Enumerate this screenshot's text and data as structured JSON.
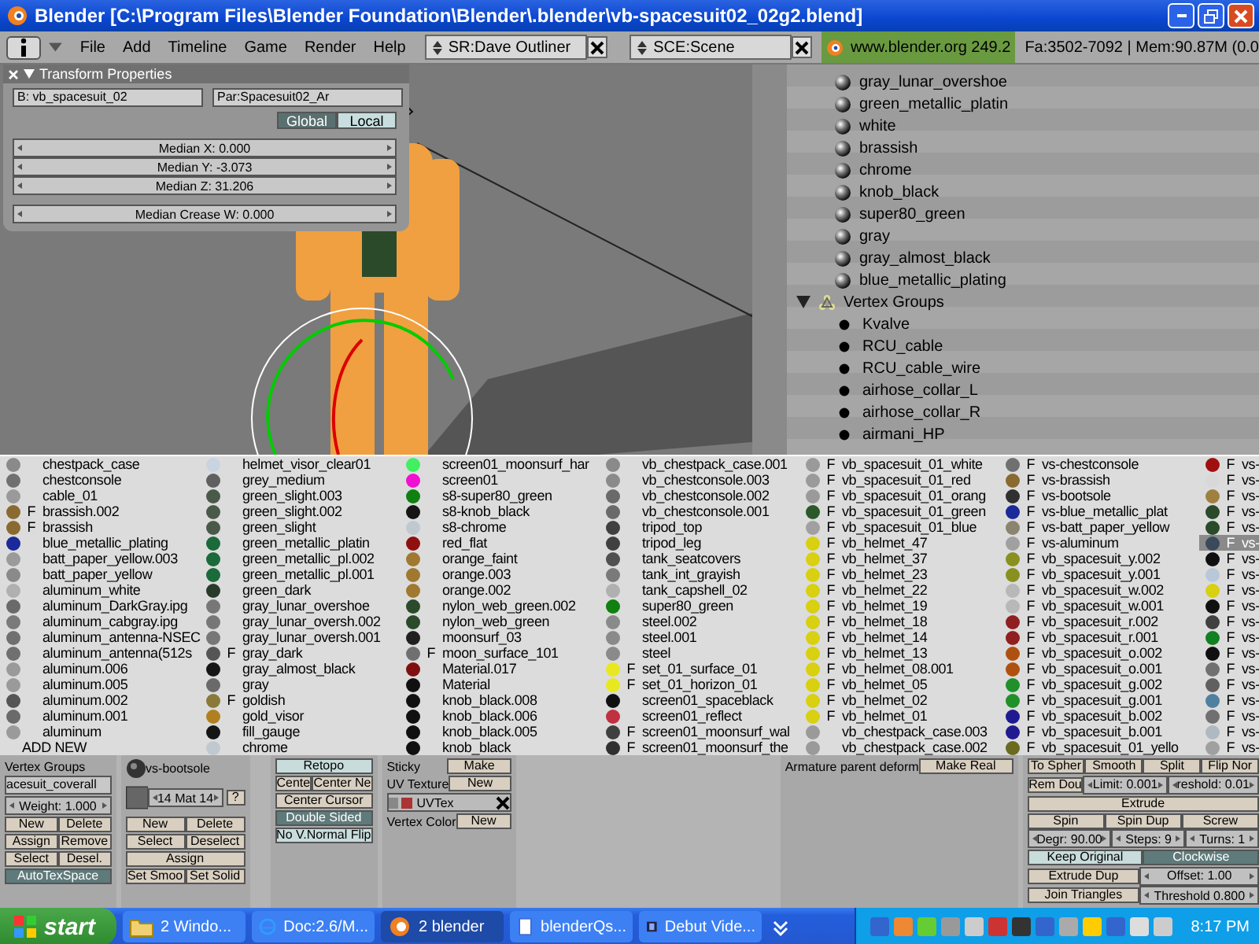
{
  "window": {
    "title": "Blender [C:\\Program Files\\Blender Foundation\\Blender\\.blender\\vb-spacesuit02_02g2.blend]"
  },
  "header": {
    "menus": [
      "File",
      "Add",
      "Timeline",
      "Game",
      "Render",
      "Help"
    ],
    "screen_field": {
      "value": "SR:Dave Outliner"
    },
    "scene_field": {
      "value": "SCE:Scene"
    },
    "version": "www.blender.org 249.2",
    "stats": "Fa:3502-7092 | Mem:90.87M (0.0"
  },
  "transform_panel": {
    "title": "Transform Properties",
    "bone_field": "B: vb_spacesuit_02",
    "parent_field": "Par:Spacesuit02_Ar",
    "toggles": [
      {
        "label": "Global",
        "selected": true
      },
      {
        "label": "Local",
        "selected": false
      }
    ],
    "fields": [
      "Median X: 0.000",
      "Median Y: -3.073",
      "Median Z: 31.206"
    ],
    "crease_field": "Median Crease W: 0.000"
  },
  "outliner": {
    "rows": [
      {
        "kind": "material",
        "label": "gray_lunar_overshoe"
      },
      {
        "kind": "material",
        "label": "green_metallic_platin"
      },
      {
        "kind": "material",
        "label": "white"
      },
      {
        "kind": "material",
        "label": "brassish"
      },
      {
        "kind": "material",
        "label": "chrome"
      },
      {
        "kind": "material",
        "label": "knob_black"
      },
      {
        "kind": "material",
        "label": "super80_green"
      },
      {
        "kind": "material",
        "label": "gray"
      },
      {
        "kind": "material",
        "label": "gray_almost_black"
      },
      {
        "kind": "material",
        "label": "blue_metallic_plating"
      },
      {
        "kind": "group",
        "label": "Vertex Groups",
        "expanded": true,
        "children": [
          {
            "label": "Kvalve"
          },
          {
            "label": "RCU_cable"
          },
          {
            "label": "RCU_cable_wire"
          },
          {
            "label": "airhose_collar_L"
          },
          {
            "label": "airhose_collar_R"
          },
          {
            "label": "airmani_HP"
          }
        ]
      }
    ]
  },
  "material_menu": {
    "columns": [
      {
        "items": [
          {
            "kind": "material",
            "name": "chestpack_case",
            "color": "#8a8a8a",
            "selected": false
          },
          {
            "kind": "material",
            "name": "chestconsole",
            "color": "#707070",
            "selected": false
          },
          {
            "kind": "material",
            "name": "cable_01",
            "color": "#9a9a9a",
            "selected": false
          },
          {
            "kind": "material",
            "flag": "F",
            "name": "brassish.002",
            "color": "#8a6a30",
            "selected": false
          },
          {
            "kind": "material",
            "flag": "F",
            "name": "brassish",
            "color": "#8a6a30",
            "selected": false
          },
          {
            "kind": "material",
            "name": "blue_metallic_plating",
            "color": "#1a2a9a",
            "selected": false
          },
          {
            "kind": "material",
            "name": "batt_paper_yellow.003",
            "color": "#9a9a9a",
            "selected": false
          },
          {
            "kind": "material",
            "name": "batt_paper_yellow",
            "color": "#8a8a8a",
            "selected": false
          },
          {
            "kind": "material",
            "name": "aluminum_white",
            "color": "#b0b0b0",
            "selected": false
          },
          {
            "kind": "material",
            "name": "aluminum_DarkGray.ipg",
            "color": "#6a6a6a",
            "selected": false
          },
          {
            "kind": "material",
            "name": "aluminum_cabgray.ipg",
            "color": "#7a7a7a",
            "selected": false
          },
          {
            "kind": "material",
            "name": "aluminum_antenna-NSEC",
            "color": "#707070",
            "selected": false
          },
          {
            "kind": "material",
            "name": "aluminum_antenna(512s",
            "color": "#707070",
            "selected": false
          },
          {
            "kind": "material",
            "name": "aluminum.006",
            "color": "#9a9a9a",
            "selected": false
          },
          {
            "kind": "material",
            "name": "aluminum.005",
            "color": "#9a9a9a",
            "selected": false
          },
          {
            "kind": "material",
            "name": "aluminum.002",
            "color": "#555555",
            "selected": false
          },
          {
            "kind": "material",
            "name": "aluminum.001",
            "color": "#6a6a6a",
            "selected": false
          },
          {
            "kind": "material",
            "name": "aluminum",
            "color": "#9a9a9a",
            "selected": false
          },
          {
            "kind": "add",
            "name": "ADD NEW",
            "selected": false
          }
        ]
      },
      {
        "items": [
          {
            "kind": "material",
            "name": "helmet_visor_clear01",
            "color": "#c8d4e0",
            "selected": false
          },
          {
            "kind": "material",
            "name": "grey_medium",
            "color": "#606060",
            "selected": false
          },
          {
            "kind": "material",
            "name": "green_slight.003",
            "color": "#4a5a4a",
            "selected": false
          },
          {
            "kind": "material",
            "name": "green_slight.002",
            "color": "#4a5a4a",
            "selected": false
          },
          {
            "kind": "material",
            "name": "green_slight",
            "color": "#4a5a4a",
            "selected": false
          },
          {
            "kind": "material",
            "name": "green_metallic_platin",
            "color": "#1a6a3a",
            "selected": false
          },
          {
            "kind": "material",
            "name": "green_metallic_pl.002",
            "color": "#1a6a3a",
            "selected": false
          },
          {
            "kind": "material",
            "name": "green_metallic_pl.001",
            "color": "#1a6a3a",
            "selected": false
          },
          {
            "kind": "material",
            "name": "green_dark",
            "color": "#2a3a2a",
            "selected": false
          },
          {
            "kind": "material",
            "name": "gray_lunar_overshoe",
            "color": "#777777",
            "selected": false
          },
          {
            "kind": "material",
            "name": "gray_lunar_oversh.002",
            "color": "#777777",
            "selected": false
          },
          {
            "kind": "material",
            "name": "gray_lunar_oversh.001",
            "color": "#777777",
            "selected": false
          },
          {
            "kind": "material",
            "flag": "F",
            "name": "gray_dark",
            "color": "#555555",
            "selected": false
          },
          {
            "kind": "material",
            "name": "gray_almost_black",
            "color": "#151515",
            "selected": false
          },
          {
            "kind": "material",
            "name": "gray",
            "color": "#6a6a6a",
            "selected": false
          },
          {
            "kind": "material",
            "flag": "F",
            "name": "goldish",
            "color": "#8a7a3a",
            "selected": false
          },
          {
            "kind": "material",
            "name": "gold_visor",
            "color": "#b08020",
            "selected": false
          },
          {
            "kind": "material",
            "name": "fill_gauge",
            "color": "#151515",
            "selected": false
          },
          {
            "kind": "material",
            "name": "chrome",
            "color": "#c0c8d0",
            "selected": false
          }
        ]
      },
      {
        "items": [
          {
            "kind": "material",
            "name": "screen01_moonsurf_har",
            "color": "#40f060",
            "selected": false
          },
          {
            "kind": "material",
            "name": "screen01",
            "color": "#f010d0",
            "selected": false
          },
          {
            "kind": "material",
            "name": "s8-super80_green",
            "color": "#108010",
            "selected": false
          },
          {
            "kind": "material",
            "name": "s8-knob_black",
            "color": "#151515",
            "selected": false
          },
          {
            "kind": "material",
            "name": "s8-chrome",
            "color": "#c0c8d0",
            "selected": false
          },
          {
            "kind": "material",
            "name": "red_flat",
            "color": "#901010",
            "selected": false
          },
          {
            "kind": "material",
            "name": "orange_faint",
            "color": "#a07830",
            "selected": false
          },
          {
            "kind": "material",
            "name": "orange.003",
            "color": "#a07830",
            "selected": false
          },
          {
            "kind": "material",
            "name": "orange.002",
            "color": "#a07830",
            "selected": false
          },
          {
            "kind": "material",
            "name": "nylon_web_green.002",
            "color": "#2a4a2a",
            "selected": false
          },
          {
            "kind": "material",
            "name": "nylon_web_green",
            "color": "#2a4a2a",
            "selected": false
          },
          {
            "kind": "material",
            "name": "moonsurf_03",
            "color": "#202020",
            "selected": false
          },
          {
            "kind": "material",
            "flag": "F",
            "name": "moon_surface_101",
            "color": "#707070",
            "selected": false
          },
          {
            "kind": "material",
            "name": "Material.017",
            "color": "#801010",
            "selected": false
          },
          {
            "kind": "material",
            "name": "Material",
            "color": "#101010",
            "selected": false
          },
          {
            "kind": "material",
            "name": "knob_black.008",
            "color": "#101010",
            "selected": false
          },
          {
            "kind": "material",
            "name": "knob_black.006",
            "color": "#101010",
            "selected": false
          },
          {
            "kind": "material",
            "name": "knob_black.005",
            "color": "#101010",
            "selected": false
          },
          {
            "kind": "material",
            "name": "knob_black",
            "color": "#101010",
            "selected": false
          }
        ]
      },
      {
        "items": [
          {
            "kind": "material",
            "name": "vb_chestpack_case.001",
            "color": "#8a8a8a",
            "selected": false
          },
          {
            "kind": "material",
            "name": "vb_chestconsole.003",
            "color": "#8a8a8a",
            "selected": false
          },
          {
            "kind": "material",
            "name": "vb_chestconsole.002",
            "color": "#6a6a6a",
            "selected": false
          },
          {
            "kind": "material",
            "name": "vb_chestconsole.001",
            "color": "#6a6a6a",
            "selected": false
          },
          {
            "kind": "material",
            "name": "tripod_top",
            "color": "#404040",
            "selected": false
          },
          {
            "kind": "material",
            "name": "tripod_leg",
            "color": "#404040",
            "selected": false
          },
          {
            "kind": "material",
            "name": "tank_seatcovers",
            "color": "#505050",
            "selected": false
          },
          {
            "kind": "material",
            "name": "tank_int_grayish",
            "color": "#7a7a7a",
            "selected": false
          },
          {
            "kind": "material",
            "name": "tank_capshell_02",
            "color": "#b0b0b0",
            "selected": false
          },
          {
            "kind": "material",
            "name": "super80_green",
            "color": "#108010",
            "selected": false
          },
          {
            "kind": "material",
            "name": "steel.002",
            "color": "#8a8a8a",
            "selected": false
          },
          {
            "kind": "material",
            "name": "steel.001",
            "color": "#8a8a8a",
            "selected": false
          },
          {
            "kind": "material",
            "name": "steel",
            "color": "#8a8a8a",
            "selected": false
          },
          {
            "kind": "material",
            "flag": "F",
            "name": "set_01_surface_01",
            "color": "#e8e820",
            "selected": false
          },
          {
            "kind": "material",
            "flag": "F",
            "name": "set_01_horizon_01",
            "color": "#e8e820",
            "selected": false
          },
          {
            "kind": "material",
            "name": "screen01_spaceblack",
            "color": "#101010",
            "selected": false
          },
          {
            "kind": "material",
            "name": "screen01_reflect",
            "color": "#c03040",
            "selected": false
          },
          {
            "kind": "material",
            "flag": "F",
            "name": "screen01_moonsurf_wal",
            "color": "#404040",
            "selected": false
          },
          {
            "kind": "material",
            "flag": "F",
            "name": "screen01_moonsurf_the",
            "color": "#303030",
            "selected": false
          }
        ]
      },
      {
        "items": [
          {
            "kind": "material",
            "flag": "F",
            "name": "vb_spacesuit_01_white",
            "color": "#9a9a9a",
            "selected": false
          },
          {
            "kind": "material",
            "flag": "F",
            "name": "vb_spacesuit_01_red",
            "color": "#9a9a9a",
            "selected": false
          },
          {
            "kind": "material",
            "flag": "F",
            "name": "vb_spacesuit_01_orang",
            "color": "#9a9a9a",
            "selected": false
          },
          {
            "kind": "material",
            "flag": "F",
            "name": "vb_spacesuit_01_green",
            "color": "#2a5a2a",
            "selected": false
          },
          {
            "kind": "material",
            "flag": "F",
            "name": "vb_spacesuit_01_blue",
            "color": "#a0a0a0",
            "selected": false
          },
          {
            "kind": "material",
            "flag": "F",
            "name": "vb_helmet_47",
            "color": "#d8d010",
            "selected": false
          },
          {
            "kind": "material",
            "flag": "F",
            "name": "vb_helmet_37",
            "color": "#d8d010",
            "selected": false
          },
          {
            "kind": "material",
            "flag": "F",
            "name": "vb_helmet_23",
            "color": "#d8d010",
            "selected": false
          },
          {
            "kind": "material",
            "flag": "F",
            "name": "vb_helmet_22",
            "color": "#d8d010",
            "selected": false
          },
          {
            "kind": "material",
            "flag": "F",
            "name": "vb_helmet_19",
            "color": "#d8d010",
            "selected": false
          },
          {
            "kind": "material",
            "flag": "F",
            "name": "vb_helmet_18",
            "color": "#d8d010",
            "selected": false
          },
          {
            "kind": "material",
            "flag": "F",
            "name": "vb_helmet_14",
            "color": "#d8d010",
            "selected": false
          },
          {
            "kind": "material",
            "flag": "F",
            "name": "vb_helmet_13",
            "color": "#d8d010",
            "selected": false
          },
          {
            "kind": "material",
            "flag": "F",
            "name": "vb_helmet_08.001",
            "color": "#d8d010",
            "selected": false
          },
          {
            "kind": "material",
            "flag": "F",
            "name": "vb_helmet_05",
            "color": "#d8d010",
            "selected": false
          },
          {
            "kind": "material",
            "flag": "F",
            "name": "vb_helmet_02",
            "color": "#d8d010",
            "selected": false
          },
          {
            "kind": "material",
            "flag": "F",
            "name": "vb_helmet_01",
            "color": "#d8d010",
            "selected": false
          },
          {
            "kind": "material",
            "name": "vb_chestpack_case.003",
            "color": "#9a9a9a",
            "selected": false
          },
          {
            "kind": "material",
            "name": "vb_chestpack_case.002",
            "color": "#9a9a9a",
            "selected": false
          }
        ]
      },
      {
        "items": [
          {
            "kind": "material",
            "flag": "F",
            "name": "vs-chestconsole",
            "color": "#707070",
            "selected": false
          },
          {
            "kind": "material",
            "flag": "F",
            "name": "vs-brassish",
            "color": "#8a6a30",
            "selected": false
          },
          {
            "kind": "material",
            "flag": "F",
            "name": "vs-bootsole",
            "color": "#303030",
            "selected": false
          },
          {
            "kind": "material",
            "flag": "F",
            "name": "vs-blue_metallic_plat",
            "color": "#1a2a9a",
            "selected": false
          },
          {
            "kind": "material",
            "flag": "F",
            "name": "vs-batt_paper_yellow",
            "color": "#8a8470",
            "selected": false
          },
          {
            "kind": "material",
            "flag": "F",
            "name": "vs-aluminum",
            "color": "#a0a0a0",
            "selected": false
          },
          {
            "kind": "material",
            "flag": "F",
            "name": "vb_spacesuit_y.002",
            "color": "#8a9020",
            "selected": false
          },
          {
            "kind": "material",
            "flag": "F",
            "name": "vb_spacesuit_y.001",
            "color": "#8a9020",
            "selected": false
          },
          {
            "kind": "material",
            "flag": "F",
            "name": "vb_spacesuit_w.002",
            "color": "#b8b8b8",
            "selected": false
          },
          {
            "kind": "material",
            "flag": "F",
            "name": "vb_spacesuit_w.001",
            "color": "#b8b8b8",
            "selected": false
          },
          {
            "kind": "material",
            "flag": "F",
            "name": "vb_spacesuit_r.002",
            "color": "#902020",
            "selected": false
          },
          {
            "kind": "material",
            "flag": "F",
            "name": "vb_spacesuit_r.001",
            "color": "#902020",
            "selected": false
          },
          {
            "kind": "material",
            "flag": "F",
            "name": "vb_spacesuit_o.002",
            "color": "#b05010",
            "selected": false
          },
          {
            "kind": "material",
            "flag": "F",
            "name": "vb_spacesuit_o.001",
            "color": "#b05010",
            "selected": false
          },
          {
            "kind": "material",
            "flag": "F",
            "name": "vb_spacesuit_g.002",
            "color": "#20902a",
            "selected": false
          },
          {
            "kind": "material",
            "flag": "F",
            "name": "vb_spacesuit_g.001",
            "color": "#20902a",
            "selected": false
          },
          {
            "kind": "material",
            "flag": "F",
            "name": "vb_spacesuit_b.002",
            "color": "#201a90",
            "selected": false
          },
          {
            "kind": "material",
            "flag": "F",
            "name": "vb_spacesuit_b.001",
            "color": "#201a90",
            "selected": false
          },
          {
            "kind": "material",
            "flag": "F",
            "name": "vb_spacesuit_01_yello",
            "color": "#6a6a20",
            "selected": false
          }
        ]
      },
      {
        "items": [
          {
            "kind": "material",
            "flag": "F",
            "name": "vs-",
            "color": "#a01010",
            "selected": false
          },
          {
            "kind": "material",
            "flag": "F",
            "name": "vs-",
            "color": "#d8d8d8",
            "selected": false
          },
          {
            "kind": "material",
            "flag": "F",
            "name": "vs-",
            "color": "#a08040",
            "selected": false
          },
          {
            "kind": "material",
            "flag": "F",
            "name": "vs-",
            "color": "#2a4a2a",
            "selected": false
          },
          {
            "kind": "material",
            "flag": "F",
            "name": "vs-",
            "color": "#2a4a2a",
            "selected": false
          },
          {
            "kind": "material",
            "flag": "F",
            "name": "vs-",
            "color": "#3a4a5a",
            "selected": true
          },
          {
            "kind": "material",
            "flag": "F",
            "name": "vs-",
            "color": "#101010",
            "selected": false
          },
          {
            "kind": "material",
            "flag": "F",
            "name": "vs-",
            "color": "#b8c8d8",
            "selected": false
          },
          {
            "kind": "material",
            "flag": "F",
            "name": "vs-",
            "color": "#d8d010",
            "selected": false
          },
          {
            "kind": "material",
            "flag": "F",
            "name": "vs-",
            "color": "#101010",
            "selected": false
          },
          {
            "kind": "material",
            "flag": "F",
            "name": "vs-",
            "color": "#404040",
            "selected": false
          },
          {
            "kind": "material",
            "flag": "F",
            "name": "vs-",
            "color": "#108020",
            "selected": false
          },
          {
            "kind": "material",
            "flag": "F",
            "name": "vs-",
            "color": "#101010",
            "selected": false
          },
          {
            "kind": "material",
            "flag": "F",
            "name": "vs-",
            "color": "#707070",
            "selected": false
          },
          {
            "kind": "material",
            "flag": "F",
            "name": "vs-",
            "color": "#606060",
            "selected": false
          },
          {
            "kind": "material",
            "flag": "F",
            "name": "vs-",
            "color": "#5080a0",
            "selected": false
          },
          {
            "kind": "material",
            "flag": "F",
            "name": "vs-",
            "color": "#707070",
            "selected": false
          },
          {
            "kind": "material",
            "flag": "F",
            "name": "vs-",
            "color": "#b0b8c0",
            "selected": false
          },
          {
            "kind": "material",
            "flag": "F",
            "name": "vs-",
            "color": "#a0a0a0",
            "selected": false
          }
        ]
      }
    ]
  },
  "buttons_window": {
    "panels": [
      {
        "rows": [
          [
            {
              "kind": "label",
              "text": "Vertex Groups"
            }
          ],
          [
            {
              "kind": "text_field",
              "text": "acesuit_coverall"
            }
          ],
          [
            {
              "kind": "num",
              "text": "Weight: 1.000"
            }
          ],
          [
            {
              "kind": "button",
              "text": "New"
            },
            {
              "kind": "button",
              "text": "Delete"
            }
          ],
          [
            {
              "kind": "button",
              "text": "Assign"
            },
            {
              "kind": "button",
              "text": "Remove"
            }
          ],
          [
            {
              "kind": "button",
              "text": "Select"
            },
            {
              "kind": "button",
              "text": "Desel."
            }
          ],
          [
            {
              "kind": "toggle",
              "text": "AutoTexSpace",
              "selected": true
            }
          ]
        ]
      },
      {
        "rows": [
          [
            {
              "kind": "ball"
            },
            {
              "kind": "label",
              "text": "vs-bootsole"
            }
          ],
          [
            {
              "kind": "swatch"
            },
            {
              "kind": "num",
              "text": "14 Mat 14"
            },
            {
              "kind": "button",
              "text": "?"
            }
          ],
          [
            {
              "kind": "button",
              "text": "New"
            },
            {
              "kind": "button",
              "text": "Delete"
            }
          ],
          [
            {
              "kind": "button",
              "text": "Select"
            },
            {
              "kind": "button",
              "text": "Deselect"
            }
          ],
          [
            {
              "kind": "button",
              "text": "Assign"
            }
          ],
          [
            {
              "kind": "button",
              "text": "Set Smoo"
            },
            {
              "kind": "button",
              "text": "Set Solid"
            }
          ]
        ]
      },
      {
        "rows": [
          [
            {
              "kind": "toggle",
              "text": "Retopo",
              "selected": false
            }
          ],
          [
            {
              "kind": "button",
              "text": "Cente"
            },
            {
              "kind": "button",
              "text": "Center Ne"
            }
          ],
          [
            {
              "kind": "button",
              "text": "Center Cursor"
            }
          ],
          [
            {
              "kind": "toggle",
              "text": "Double Sided",
              "selected": true
            }
          ],
          [
            {
              "kind": "toggle",
              "text": "No V.Normal Flip",
              "selected": false
            }
          ]
        ]
      },
      {
        "rows": [
          [
            {
              "kind": "label",
              "text": "Sticky"
            },
            {
              "kind": "button",
              "text": "Make"
            }
          ],
          [
            {
              "kind": "label",
              "text": "UV Texture"
            },
            {
              "kind": "button",
              "text": "New"
            }
          ],
          [
            {
              "kind": "uvtex",
              "text": "UVTex"
            }
          ],
          [
            {
              "kind": "label",
              "text": "Vertex Color"
            },
            {
              "kind": "button",
              "text": "New"
            }
          ]
        ]
      },
      {
        "rows": [
          [
            {
              "kind": "label",
              "text": "Armature parent deform"
            },
            {
              "kind": "button",
              "text": "Make Real"
            }
          ]
        ]
      },
      {
        "rows": [
          [
            {
              "kind": "button",
              "text": "To Spher"
            },
            {
              "kind": "button",
              "text": "Smooth"
            },
            {
              "kind": "button",
              "text": "Split"
            },
            {
              "kind": "button",
              "text": "Flip Nor"
            }
          ],
          [
            {
              "kind": "button",
              "text": "Rem Dou"
            },
            {
              "kind": "num",
              "text": "Limit: 0.001"
            },
            {
              "kind": "num",
              "text": "reshold: 0.01"
            }
          ],
          [
            {
              "kind": "button",
              "text": "Extrude"
            }
          ],
          [
            {
              "kind": "button",
              "text": "Spin"
            },
            {
              "kind": "button",
              "text": "Spin Dup"
            },
            {
              "kind": "button",
              "text": "Screw"
            }
          ],
          [
            {
              "kind": "num",
              "text": "Degr: 90.00"
            },
            {
              "kind": "num",
              "text": "Steps: 9"
            },
            {
              "kind": "num",
              "text": "Turns: 1"
            }
          ],
          [
            {
              "kind": "toggle",
              "text": "Keep Original",
              "selected": false
            },
            {
              "kind": "toggle",
              "text": "Clockwise",
              "selected": true
            }
          ],
          [
            {
              "kind": "button",
              "text": "Extrude Dup"
            },
            {
              "kind": "num",
              "text": "Offset: 1.00"
            }
          ],
          [
            {
              "kind": "button",
              "text": "Join Triangles"
            },
            {
              "kind": "num",
              "text": "Threshold 0.800"
            }
          ]
        ]
      }
    ]
  },
  "taskbar": {
    "start": "start",
    "tasks": [
      {
        "kind": "folder",
        "label": "2 Windo...",
        "selected": false
      },
      {
        "kind": "browser",
        "label": "Doc:2.6/M...",
        "selected": false
      },
      {
        "kind": "blender",
        "label": "2 blender",
        "selected": true
      },
      {
        "kind": "document",
        "label": "blenderQs...",
        "selected": false
      },
      {
        "kind": "video",
        "label": "Debut Vide...",
        "selected": false
      }
    ],
    "clock": "8:17 PM"
  }
}
